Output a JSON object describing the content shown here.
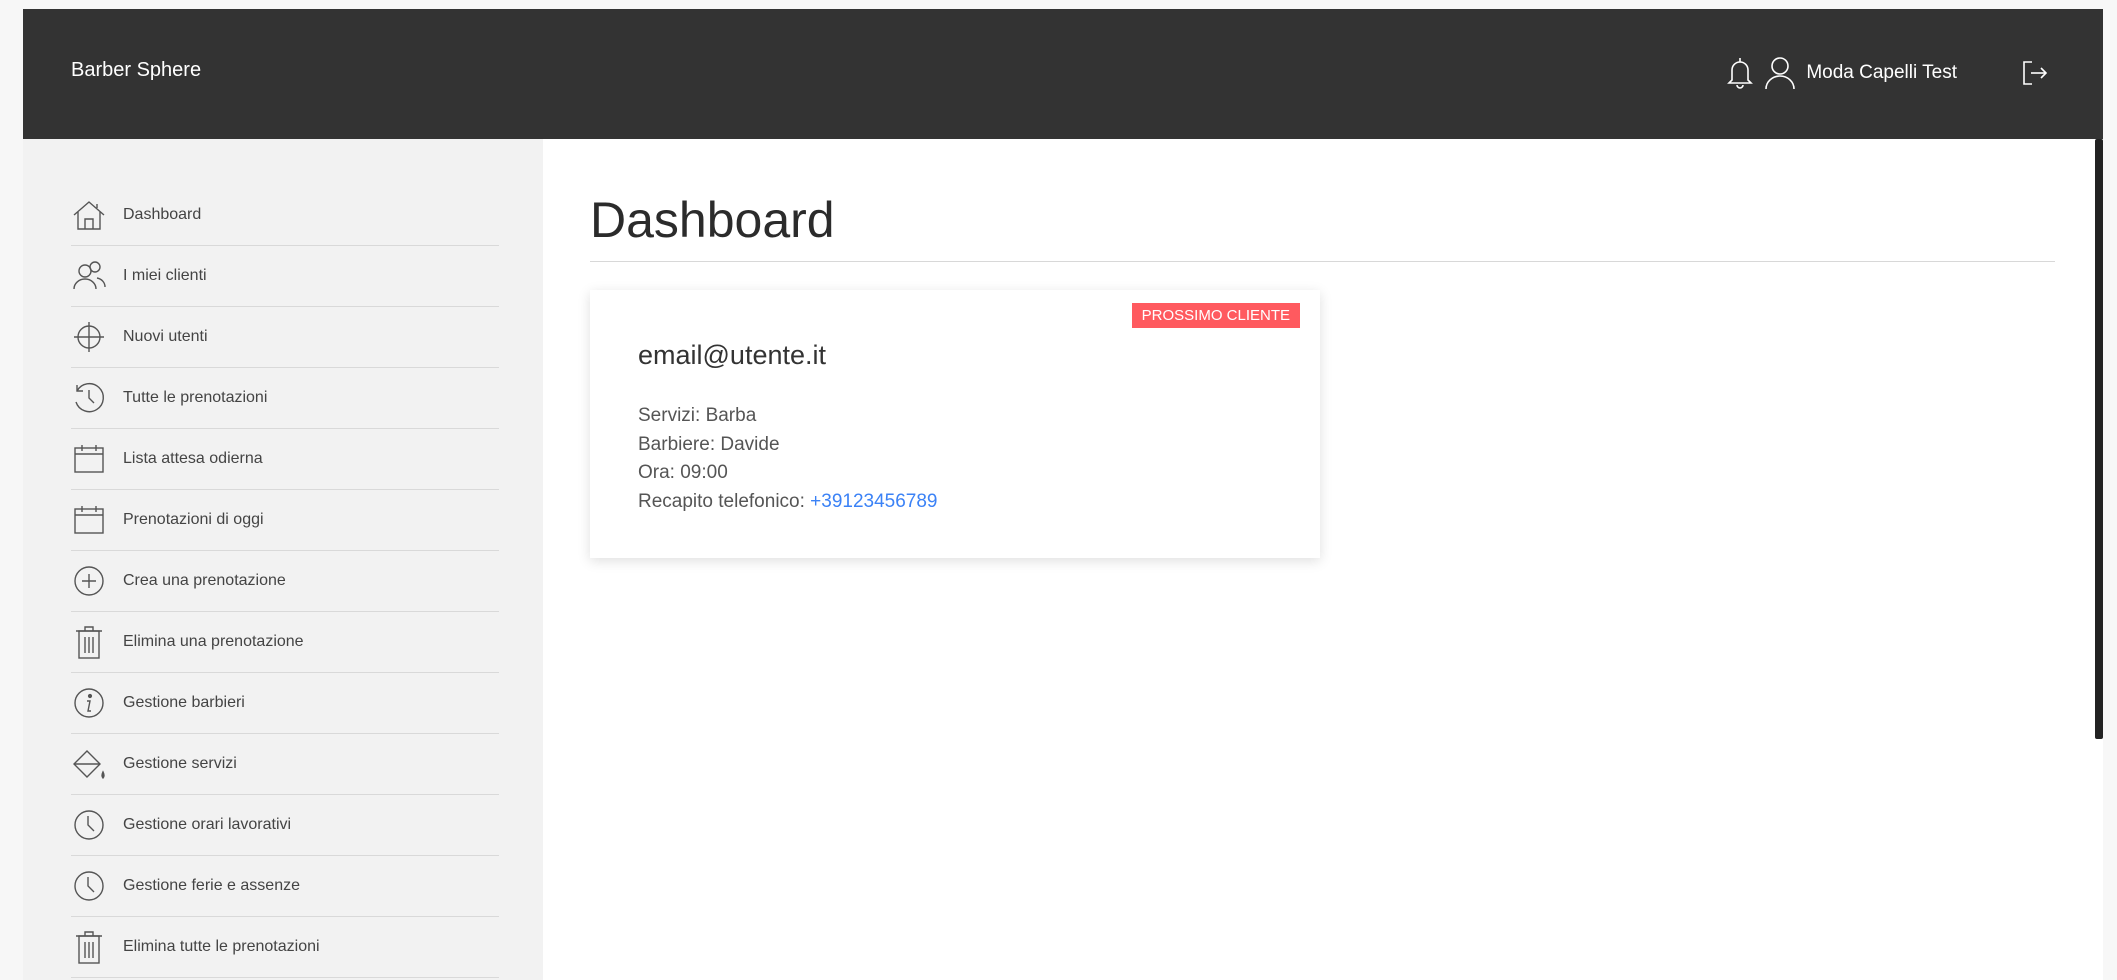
{
  "app": {
    "brand": "Barber Sphere"
  },
  "header": {
    "username": "Moda Capelli Test"
  },
  "sidebar": {
    "items": [
      {
        "label": "Dashboard",
        "icon": "house-icon"
      },
      {
        "label": "I miei clienti",
        "icon": "users-icon"
      },
      {
        "label": "Nuovi utenti",
        "icon": "crosshair-icon"
      },
      {
        "label": "Tutte le prenotazioni",
        "icon": "history-icon"
      },
      {
        "label": "Lista attesa odierna",
        "icon": "calendar-icon"
      },
      {
        "label": "Prenotazioni di oggi",
        "icon": "calendar-icon"
      },
      {
        "label": "Crea una prenotazione",
        "icon": "plus-circle-icon"
      },
      {
        "label": "Elimina una prenotazione",
        "icon": "trash-icon"
      },
      {
        "label": "Gestione barbieri",
        "icon": "info-circle-icon"
      },
      {
        "label": "Gestione servizi",
        "icon": "paint-bucket-icon"
      },
      {
        "label": "Gestione orari lavorativi",
        "icon": "clock-icon"
      },
      {
        "label": "Gestione ferie e assenze",
        "icon": "clock-icon"
      },
      {
        "label": "Elimina tutte le prenotazioni",
        "icon": "trash-icon"
      }
    ]
  },
  "main": {
    "title": "Dashboard",
    "card": {
      "badge": "PROSSIMO CLIENTE",
      "email": "email@utente.it",
      "services": "Servizi: Barba",
      "barber": "Barbiere: Davide",
      "time": "Ora: 09:00",
      "phone_label": "Recapito telefonico:",
      "phone": "+39123456789"
    }
  },
  "colors": {
    "topbar": "#333333",
    "sidebar": "#f2f2f2",
    "badge": "#ff5a5f",
    "link": "#3b82f6"
  }
}
